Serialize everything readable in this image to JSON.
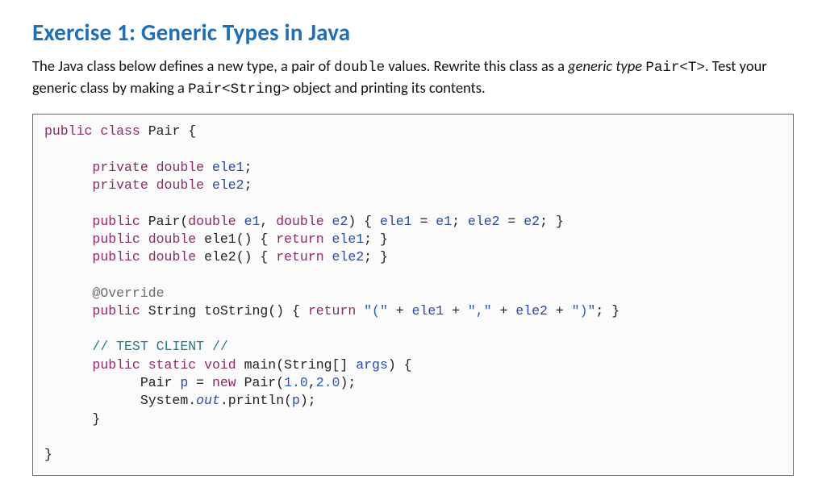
{
  "heading": "Exercise 1: Generic Types in Java",
  "desc": {
    "t1": "The Java class below defines a new type, a pair of ",
    "m1": "double",
    "t2": " values. Rewrite this class as a ",
    "i1": "generic type",
    "t3": " ",
    "m2": "Pair<T>",
    "t4": ". Test your generic class by making a ",
    "m3": "Pair<String>",
    "t5": " object and printing its contents."
  },
  "code": {
    "kw_public": "public",
    "kw_class": "class",
    "kw_private": "private",
    "kw_double": "double",
    "kw_return": "return",
    "kw_static": "static",
    "kw_void": "void",
    "kw_new": "new",
    "name_Pair": "Pair",
    "name_String": "String",
    "name_System": "System",
    "name_println": "println",
    "name_toString": "toString",
    "name_main": "main",
    "id_ele1": "ele1",
    "id_ele2": "ele2",
    "id_e1": "e1",
    "id_e2": "e2",
    "id_p": "p",
    "id_args": "args",
    "id_out": "out",
    "ann_override": "@Override",
    "cmt_test": "// TEST CLIENT //",
    "str_open": "\"(\"",
    "str_comma": "\",\"",
    "str_close": "\")\"",
    "num_1": "1.0",
    "num_2": "2.0"
  }
}
